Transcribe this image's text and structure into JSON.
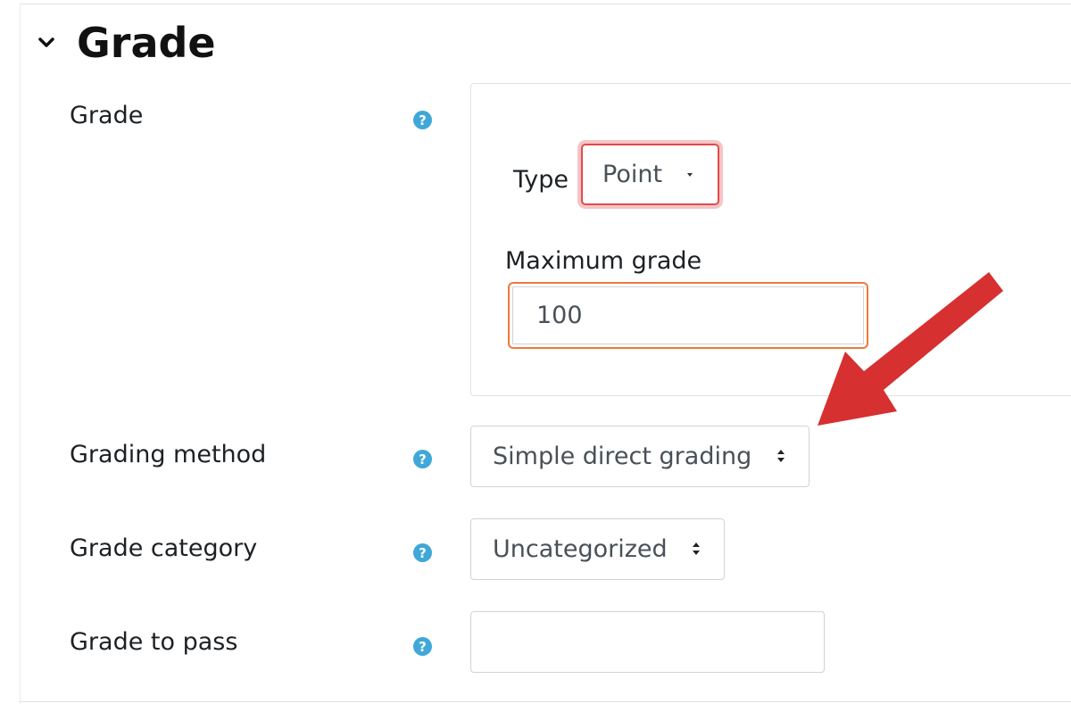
{
  "section": {
    "title": "Grade"
  },
  "fields": {
    "grade": {
      "label": "Grade",
      "help": "?"
    },
    "type": {
      "label": "Type",
      "value": "Point"
    },
    "max_grade": {
      "label": "Maximum grade",
      "value": "100"
    },
    "grading_method": {
      "label": "Grading method",
      "help": "?",
      "value": "Simple direct grading"
    },
    "grade_category": {
      "label": "Grade category",
      "help": "?",
      "value": "Uncategorized"
    },
    "grade_to_pass": {
      "label": "Grade to pass",
      "help": "?",
      "value": ""
    }
  },
  "icons": {
    "collapse": "chevron-down-icon",
    "help": "question-circle-icon",
    "annotation": "red-arrow-annotation"
  },
  "colors": {
    "help_icon": "#3fa8d8",
    "type_highlight": "#e34a4a",
    "max_grade_highlight": "#f0793b",
    "arrow": "#d63031"
  }
}
